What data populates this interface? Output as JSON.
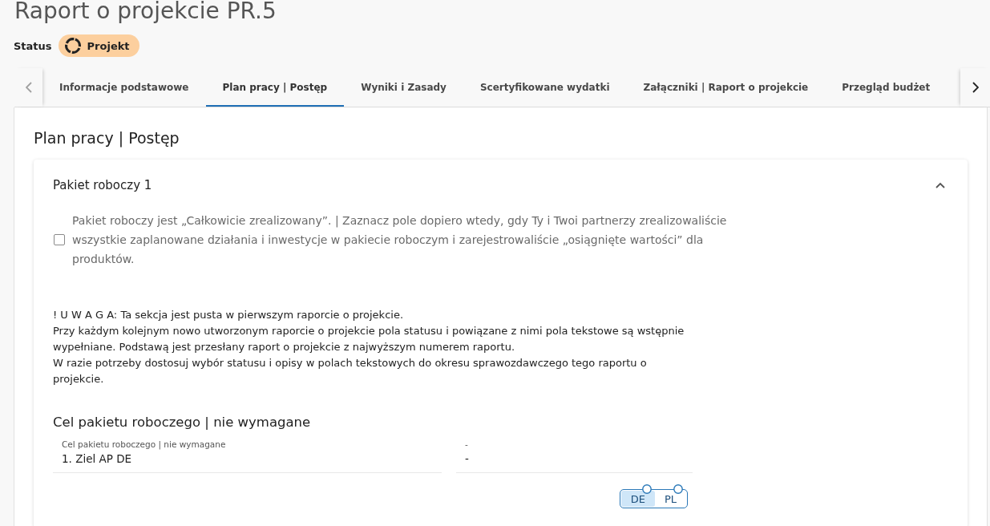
{
  "page": {
    "title": "Raport o projekcie PR.5",
    "status_label": "Status",
    "status": "Projekt"
  },
  "tabs": {
    "scroll_back": {
      "disabled": true
    },
    "scroll_forward": {
      "disabled": false
    },
    "items": [
      {
        "label": "Informacje podstawowe",
        "selected": false
      },
      {
        "label": "Plan pracy | Postęp",
        "selected": true
      },
      {
        "label": "Wyniki i Zasady",
        "selected": false
      },
      {
        "label": "Scertyfikowane wydatki",
        "selected": false
      },
      {
        "label": "Załączniki | Raport o projekcie",
        "selected": false
      },
      {
        "label": "Przegląd budżet",
        "selected": false
      }
    ]
  },
  "section": {
    "title": "Plan pracy | Postęp",
    "work_package": {
      "title": "Pakiet roboczy 1",
      "expanded": true,
      "completion": {
        "label": "Pakiet roboczy jest „Całkowicie zrealizowany”. | Zaznacz pole dopiero wtedy, gdy Ty i Twoi partnerzy zrealizowaliście wszystkie zaplanowane działania i inwestycje w pakiecie roboczym i zarejestrowaliście „osiągnięte wartości” dla produktów.",
        "checked": false
      },
      "notice": [
        "! U W A G A: Ta sekcja jest pusta w pierwszym raporcie o projekcie.",
        "Przy każdym kolejnym nowo utworzonym raporcie o projekcie pola statusu i powiązane z nimi pola tekstowe są wstępnie wypełniane. Podstawą jest przesłany raport o projekcie z najwyższym numerem raportu.",
        "W razie potrzeby dostosuj wybór statusu i opisy w polach tekstowych do okresu sprawozdawczego tego raportu o projekcie."
      ],
      "objective": {
        "title": "Cel pakietu roboczego | nie wymagane",
        "fields": [
          {
            "label": "Cel pakietu roboczego | nie wymagane",
            "value": "1. Ziel AP DE"
          },
          {
            "label": "-",
            "value": "-"
          }
        ],
        "languages": [
          {
            "label": "DE",
            "selected": true
          },
          {
            "label": "PL",
            "selected": false
          }
        ]
      }
    }
  }
}
